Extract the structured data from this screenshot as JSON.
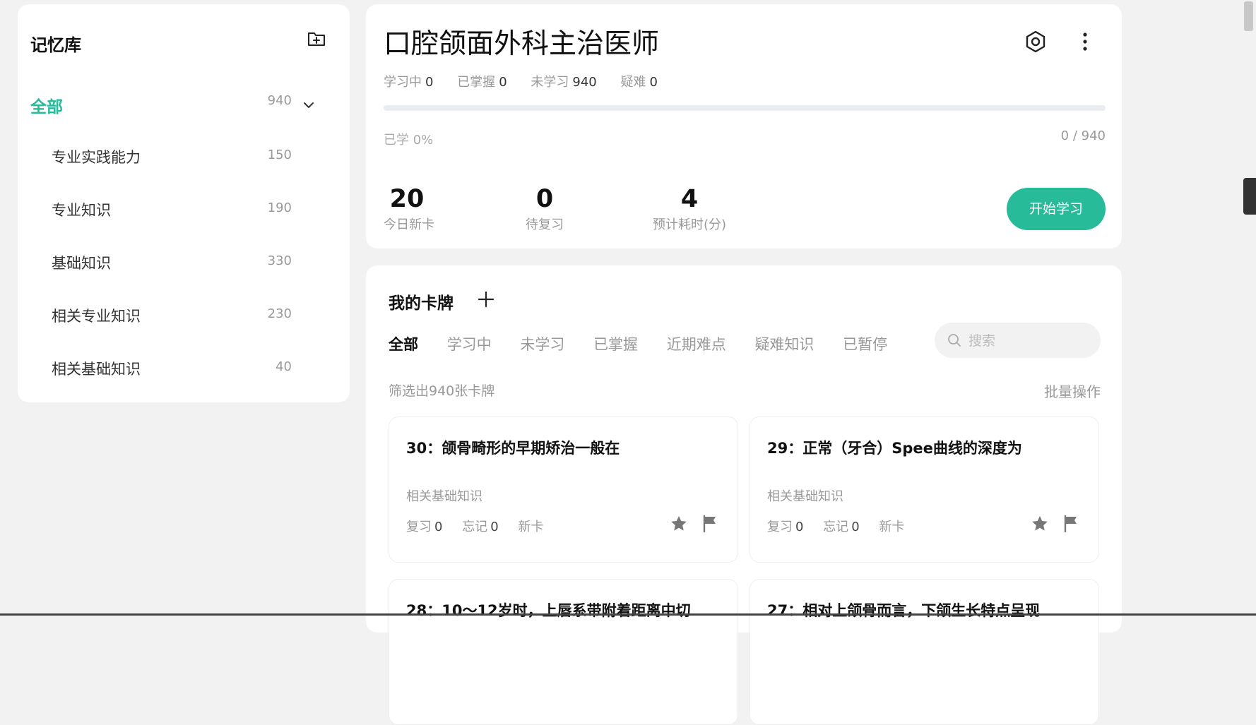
{
  "sidebar": {
    "title": "记忆库",
    "all": {
      "label": "全部",
      "count": "940"
    },
    "items": [
      {
        "label": "专业实践能力",
        "count": "150"
      },
      {
        "label": "专业知识",
        "count": "190"
      },
      {
        "label": "基础知识",
        "count": "330"
      },
      {
        "label": "相关专业知识",
        "count": "230"
      },
      {
        "label": "相关基础知识",
        "count": "40"
      }
    ]
  },
  "deck": {
    "title": "口腔颌面外科主治医师",
    "stats": [
      {
        "label": "学习中",
        "value": "0"
      },
      {
        "label": "已掌握",
        "value": "0"
      },
      {
        "label": "未学习",
        "value": "940"
      },
      {
        "label": "疑难",
        "value": "0"
      }
    ],
    "progress_fraction": 0,
    "progress_label": "已学 0%",
    "progress_count": "0 / 940",
    "metrics": [
      {
        "value": "20",
        "label": "今日新卡"
      },
      {
        "value": "0",
        "label": "待复习"
      },
      {
        "value": "4",
        "label": "预计耗时(分)"
      }
    ],
    "start_button": "开始学习"
  },
  "cards_section": {
    "title": "我的卡牌",
    "tabs": [
      "全部",
      "学习中",
      "未学习",
      "已掌握",
      "近期难点",
      "疑难知识",
      "已暂停"
    ],
    "active_tab": "全部",
    "search_placeholder": "搜索",
    "filter_text": "筛选出940张卡牌",
    "batch_label": "批量操作",
    "cards": [
      {
        "title": "30：颌骨畸形的早期矫治一般在",
        "category": "相关基础知识",
        "review_label": "复习",
        "review": "0",
        "forget_label": "忘记",
        "forget": "0",
        "status": "新卡"
      },
      {
        "title": "29：正常（牙合）Spee曲线的深度为",
        "category": "相关基础知识",
        "review_label": "复习",
        "review": "0",
        "forget_label": "忘记",
        "forget": "0",
        "status": "新卡"
      },
      {
        "title": "28：10～12岁时，上唇系带附着距离中切",
        "category": "",
        "review_label": "",
        "review": "",
        "forget_label": "",
        "forget": "",
        "status": ""
      },
      {
        "title": "27：相对上颌骨而言，下颌生长特点呈现",
        "category": "",
        "review_label": "",
        "review": "",
        "forget_label": "",
        "forget": "",
        "status": ""
      }
    ]
  },
  "colors": {
    "accent": "#27bb9a",
    "background": "#f2f2f2",
    "panel": "#ffffff",
    "muted": "#999999"
  },
  "icons": [
    "folder-add-icon",
    "chevron-down-icon",
    "target-icon",
    "more-vertical-icon",
    "plus-icon",
    "search-icon",
    "star-icon",
    "flag-icon"
  ]
}
